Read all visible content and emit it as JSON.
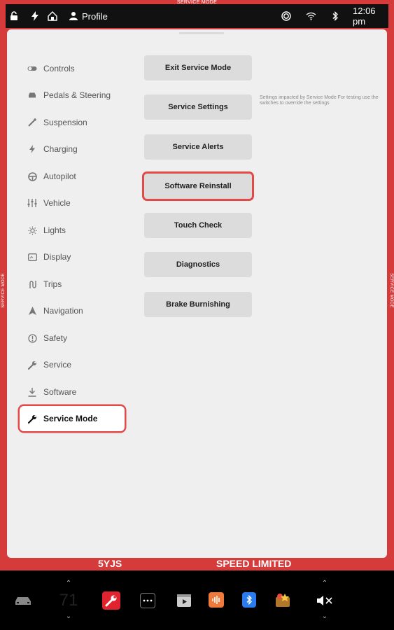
{
  "status_bar": {
    "mode_banner": "SERVICE MODE",
    "side_label_left": "SERVICE MODE",
    "side_label_right": "SERVICE MODE",
    "profile_label": "Profile",
    "time": "12:06 pm"
  },
  "sidebar": {
    "items": [
      {
        "label": "Controls",
        "icon": "toggle-icon"
      },
      {
        "label": "Pedals & Steering",
        "icon": "car-icon"
      },
      {
        "label": "Suspension",
        "icon": "suspension-icon"
      },
      {
        "label": "Charging",
        "icon": "bolt-icon"
      },
      {
        "label": "Autopilot",
        "icon": "steering-wheel-icon"
      },
      {
        "label": "Vehicle",
        "icon": "sliders-icon"
      },
      {
        "label": "Lights",
        "icon": "sun-icon"
      },
      {
        "label": "Display",
        "icon": "display-icon"
      },
      {
        "label": "Trips",
        "icon": "trips-icon"
      },
      {
        "label": "Navigation",
        "icon": "navigation-arrow-icon"
      },
      {
        "label": "Safety",
        "icon": "alert-circle-icon"
      },
      {
        "label": "Service",
        "icon": "wrench-icon"
      },
      {
        "label": "Software",
        "icon": "download-icon"
      },
      {
        "label": "Service Mode",
        "icon": "wrench-icon",
        "active": true
      }
    ]
  },
  "main": {
    "buttons": [
      {
        "label": "Exit Service Mode"
      },
      {
        "label": "Service Settings"
      },
      {
        "label": "Service Alerts"
      },
      {
        "label": "Software Reinstall",
        "highlighted": true
      },
      {
        "label": "Touch Check"
      },
      {
        "label": "Diagnostics"
      },
      {
        "label": "Brake Burnishing"
      }
    ],
    "service_settings_hint": "Settings impacted by Service Mode For testing use the switches to override the settings"
  },
  "info_bar": {
    "plate": "5YJS",
    "speed_limited": "SPEED LIMITED"
  },
  "dock": {
    "temperature": "71",
    "up_arrow": "⌃",
    "down_arrow": "⌄"
  },
  "colors": {
    "accent_red": "#d63b3b",
    "highlight_ring": "#e24a4a",
    "panel_bg": "#efefef",
    "button_bg": "#dcdcdc"
  }
}
